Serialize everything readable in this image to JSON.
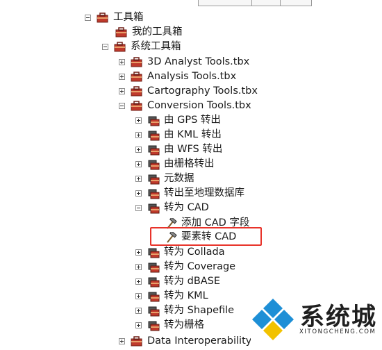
{
  "tree": {
    "toolbox_root": "工具箱",
    "my_toolbox": "我的工具箱",
    "system_toolbox": "系统工具箱",
    "items": [
      "3D Analyst Tools.tbx",
      "Analysis Tools.tbx",
      "Cartography Tools.tbx",
      "Conversion Tools.tbx"
    ],
    "conversion_children": [
      "由 GPS 转出",
      "由 KML 转出",
      "由 WFS 转出",
      "由栅格转出",
      "元数据",
      "转出至地理数据库",
      "转为 CAD"
    ],
    "to_cad_children": [
      "添加 CAD 字段",
      "要素转 CAD"
    ],
    "conversion_more": [
      "转为 Collada",
      "转为 Coverage",
      "转为 dBASE",
      "转为 KML",
      "转为 Shapefile",
      "转为栅格"
    ],
    "last_item": "Data Interoperability To"
  },
  "watermark": {
    "brand": "系统城",
    "url": "XITONGCHENG.COM"
  },
  "colors": {
    "highlight": "#e8332a",
    "watermark_blue": "#1e8fd6"
  }
}
